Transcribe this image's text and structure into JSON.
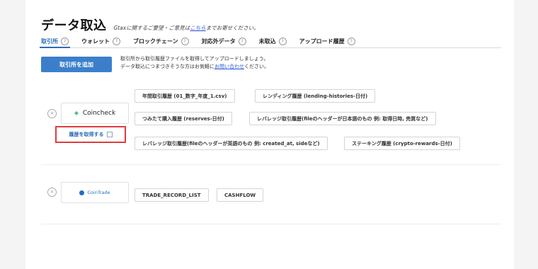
{
  "header": {
    "title": "データ取込",
    "subtitle_pre": "Gtaxに関するご要望・ご意見は",
    "subtitle_link": "こちら",
    "subtitle_post": "までお寄せください。"
  },
  "tabs": [
    {
      "label": "取引所",
      "active": true
    },
    {
      "label": "ウォレット"
    },
    {
      "label": "ブロックチェーン"
    },
    {
      "label": "対応外データ"
    },
    {
      "label": "未取込"
    },
    {
      "label": "アップロード履歴"
    }
  ],
  "help_glyph": "?",
  "add_button": {
    "label": "取引所を追加"
  },
  "intro": {
    "line1": "取引所から取引履歴ファイルを取得してアップロードしましょう。",
    "line2_pre": "データ取込につまづきそうな方はお気軽に",
    "line2_link": "お問い合わせ",
    "line2_post": "ください。"
  },
  "exchanges": [
    {
      "name": "Coincheck",
      "remove_glyph": "×",
      "get_history_label": "履歴を取得する",
      "files": [
        "年間取引履歴 (01_数字_年度_1.csv)",
        "レンディング履歴 (lending-histories-日付)",
        "つみたて購入履歴 (reserves-日付)",
        "レバレッジ取引履歴(fileのヘッダーが日本語のもの 例: 取得日時, 売買など)",
        "レバレッジ取引履歴(fileのヘッダーが英語のもの 例: created_at, sideなど)",
        "ステーキング履歴 (crypto-rewards-日付)"
      ]
    },
    {
      "name": "CoinTrade",
      "remove_glyph": "×",
      "files": [
        "TRADE_RECORD_LIST",
        "CASHFLOW"
      ]
    }
  ],
  "colors": {
    "accent": "#3b7fcb",
    "highlight_border": "#e03c3c",
    "link": "#2a57d6"
  }
}
